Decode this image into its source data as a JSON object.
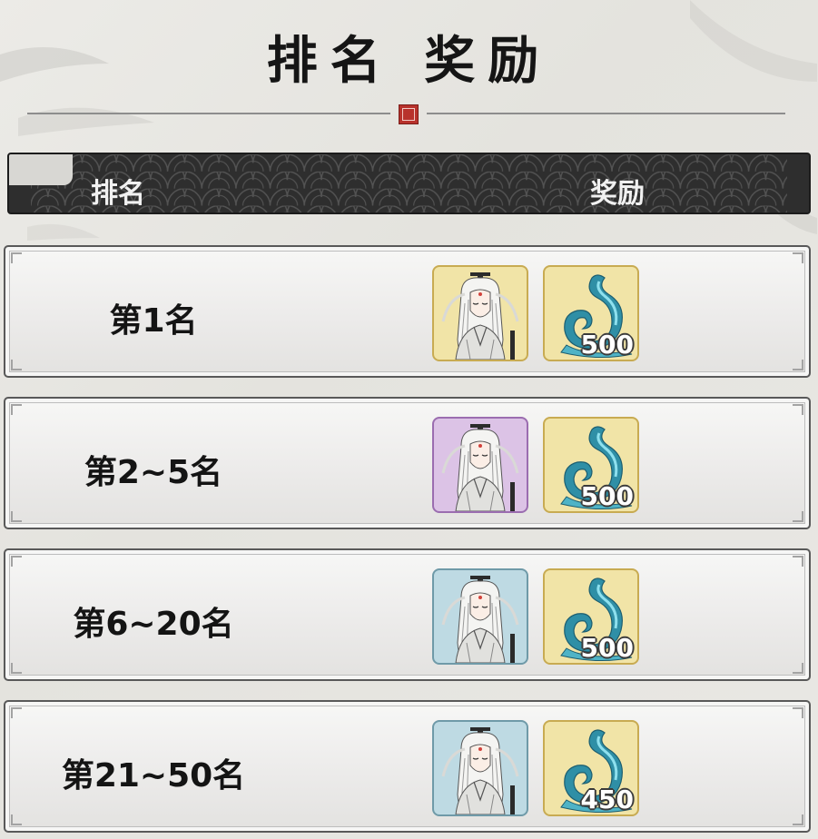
{
  "title": "排名 奖励",
  "header": {
    "rank_label": "排名",
    "reward_label": "奖励"
  },
  "colors": {
    "gold_frame": "#f1e4a7",
    "purple_frame": "#dcc3e6",
    "blue_frame": "#bedae3",
    "seal_red": "#b8322c",
    "header_dark": "#2e2e2e"
  },
  "rows": [
    {
      "rank": "第1名",
      "hero_quality": "gold",
      "hero_icon": "white-haired-swordsman-portrait-icon",
      "currency_icon": "jade-wave-icon",
      "quantity": "500"
    },
    {
      "rank": "第2~5名",
      "hero_quality": "purple",
      "hero_icon": "white-haired-swordsman-portrait-icon",
      "currency_icon": "jade-wave-icon",
      "quantity": "500"
    },
    {
      "rank": "第6~20名",
      "hero_quality": "blue",
      "hero_icon": "white-haired-swordsman-portrait-icon",
      "currency_icon": "jade-wave-icon",
      "quantity": "500"
    },
    {
      "rank": "第21~50名",
      "hero_quality": "blue",
      "hero_icon": "white-haired-swordsman-portrait-icon",
      "currency_icon": "jade-wave-icon",
      "quantity": "450"
    }
  ]
}
